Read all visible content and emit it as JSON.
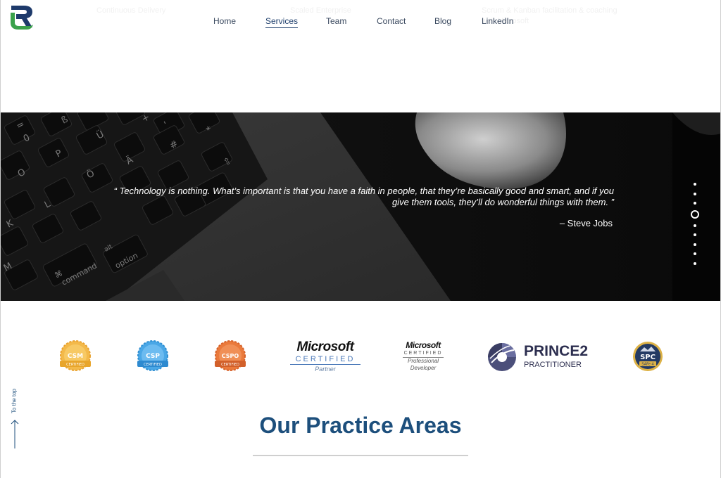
{
  "nav": {
    "items": [
      {
        "label": "Home"
      },
      {
        "label": "Services"
      },
      {
        "label": "Team"
      },
      {
        "label": "Contact"
      },
      {
        "label": "Blog"
      },
      {
        "label": "LinkedIn"
      }
    ],
    "active": "Services"
  },
  "ghost_text": {
    "left": "Continuous Delivery",
    "mid": "Scaled Enterprise",
    "right_1": "Scrum & Kanban facilitation & coaching",
    "right_2": "with Microsoft"
  },
  "hero": {
    "quote": "“ Technology is nothing. What’s important is that you have a faith in people, that they’re basically good and smart, and if you give them tools, they’ll do wonderful things with them. ”",
    "author": "– Steve Jobs",
    "slide_count": 10,
    "active_slide": 4
  },
  "badges": {
    "csm": {
      "top": "CSM",
      "bottom": "CERTIFIED"
    },
    "csp": {
      "top": "CSP",
      "bottom": "CERTIFIED"
    },
    "cspo": {
      "top": "CSPO",
      "bottom": "CERTIFIED"
    },
    "ms_partner": {
      "word": "Microsoft",
      "cert": "CERTIFIED",
      "sub": "Partner"
    },
    "ms_dev": {
      "word": "Microsoft",
      "cert": "CERTIFIED",
      "sub1": "Professional",
      "sub2": "Developer"
    },
    "prince2": {
      "word": "PRINCE2",
      "sub": "PRACTITIONER"
    },
    "spc": {
      "top": "SPC",
      "bottom": "SAFe 4"
    }
  },
  "section": {
    "title": "Our Practice Areas"
  },
  "to_top": {
    "label": "To the top"
  },
  "colors": {
    "accent": "#1d4f7c",
    "logo_green": "#3aa14a",
    "logo_navy": "#1e3a6b"
  }
}
